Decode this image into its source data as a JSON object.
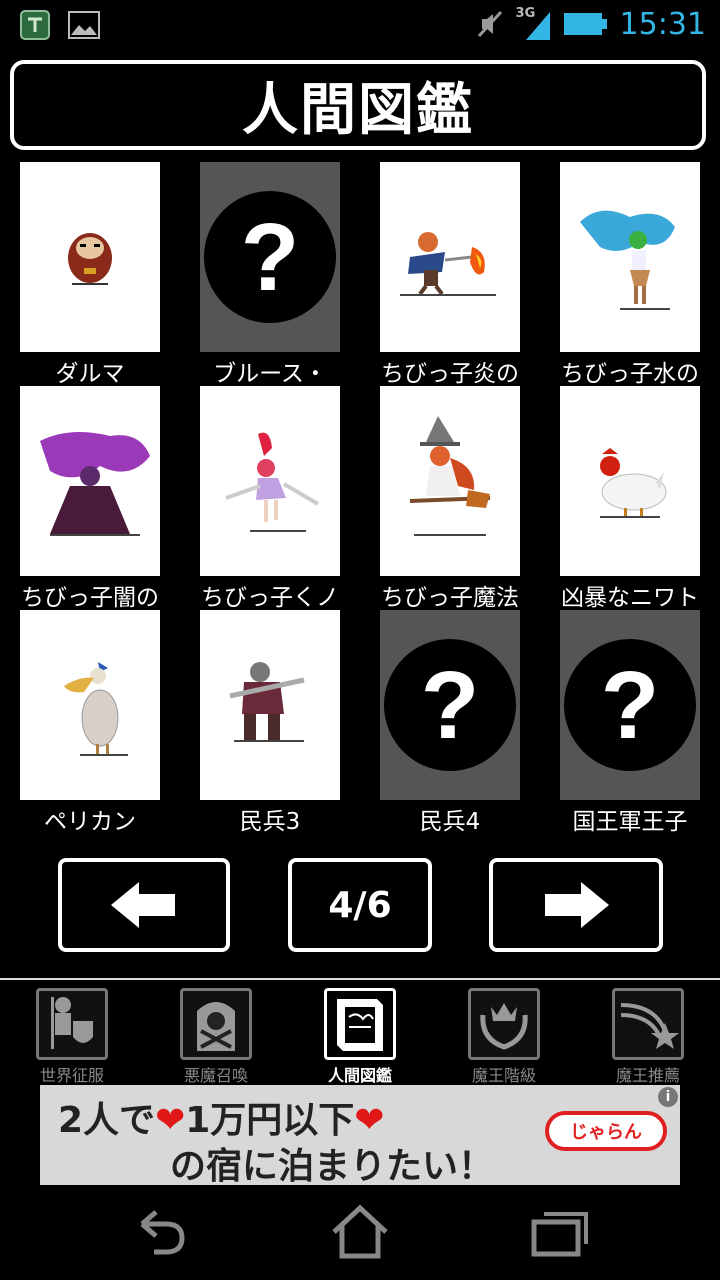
{
  "status_bar": {
    "time": "15:31",
    "network": "3G",
    "icons": [
      "shield-app-icon",
      "picture-notification-icon",
      "mute-icon",
      "signal-icon",
      "battery-icon"
    ],
    "time_color": "#33b5e5"
  },
  "header": {
    "title": "人間図鑑"
  },
  "grid": {
    "items": [
      {
        "label": "ダルマ",
        "unlocked": true,
        "icon": "daruma-sprite"
      },
      {
        "label": "ブルース・",
        "unlocked": false,
        "icon": "question-mark-icon"
      },
      {
        "label": "ちびっ子炎の",
        "unlocked": true,
        "icon": "fire-girl-sprite"
      },
      {
        "label": "ちびっ子水の",
        "unlocked": true,
        "icon": "water-girl-sprite"
      },
      {
        "label": "ちびっ子闇の",
        "unlocked": true,
        "icon": "dark-mage-sprite"
      },
      {
        "label": "ちびっ子くノ",
        "unlocked": true,
        "icon": "kunoichi-sprite"
      },
      {
        "label": "ちびっ子魔法",
        "unlocked": true,
        "icon": "witch-sprite"
      },
      {
        "label": "凶暴なニワト",
        "unlocked": true,
        "icon": "chicken-sprite"
      },
      {
        "label": "ペリカン",
        "unlocked": true,
        "icon": "pelican-sprite"
      },
      {
        "label": "民兵3",
        "unlocked": true,
        "icon": "militia-sprite"
      },
      {
        "label": "民兵4",
        "unlocked": false,
        "icon": "question-mark-icon"
      },
      {
        "label": "国王軍王子",
        "unlocked": false,
        "icon": "question-mark-icon"
      }
    ]
  },
  "pager": {
    "page": "4/6",
    "prev_icon": "arrow-left-icon",
    "next_icon": "arrow-right-icon"
  },
  "tabs": [
    {
      "label": "世界征服",
      "icon": "knight-icon",
      "active": false
    },
    {
      "label": "悪魔召喚",
      "icon": "skull-tombstone-icon",
      "active": false
    },
    {
      "label": "人間図鑑",
      "icon": "book-icon",
      "active": true
    },
    {
      "label": "魔王階級",
      "icon": "crown-laurel-icon",
      "active": false
    },
    {
      "label": "魔王推薦",
      "icon": "shooting-star-icon",
      "active": false
    }
  ],
  "ad": {
    "line1a": "2人で",
    "line1b": "1万円以下",
    "line2": "の宿に泊まりたい！",
    "heart": "❤",
    "brand": "じゃらん",
    "info_icon": "i"
  },
  "nav_bar": {
    "icons": [
      "back-icon",
      "home-icon",
      "recent-apps-icon"
    ]
  }
}
